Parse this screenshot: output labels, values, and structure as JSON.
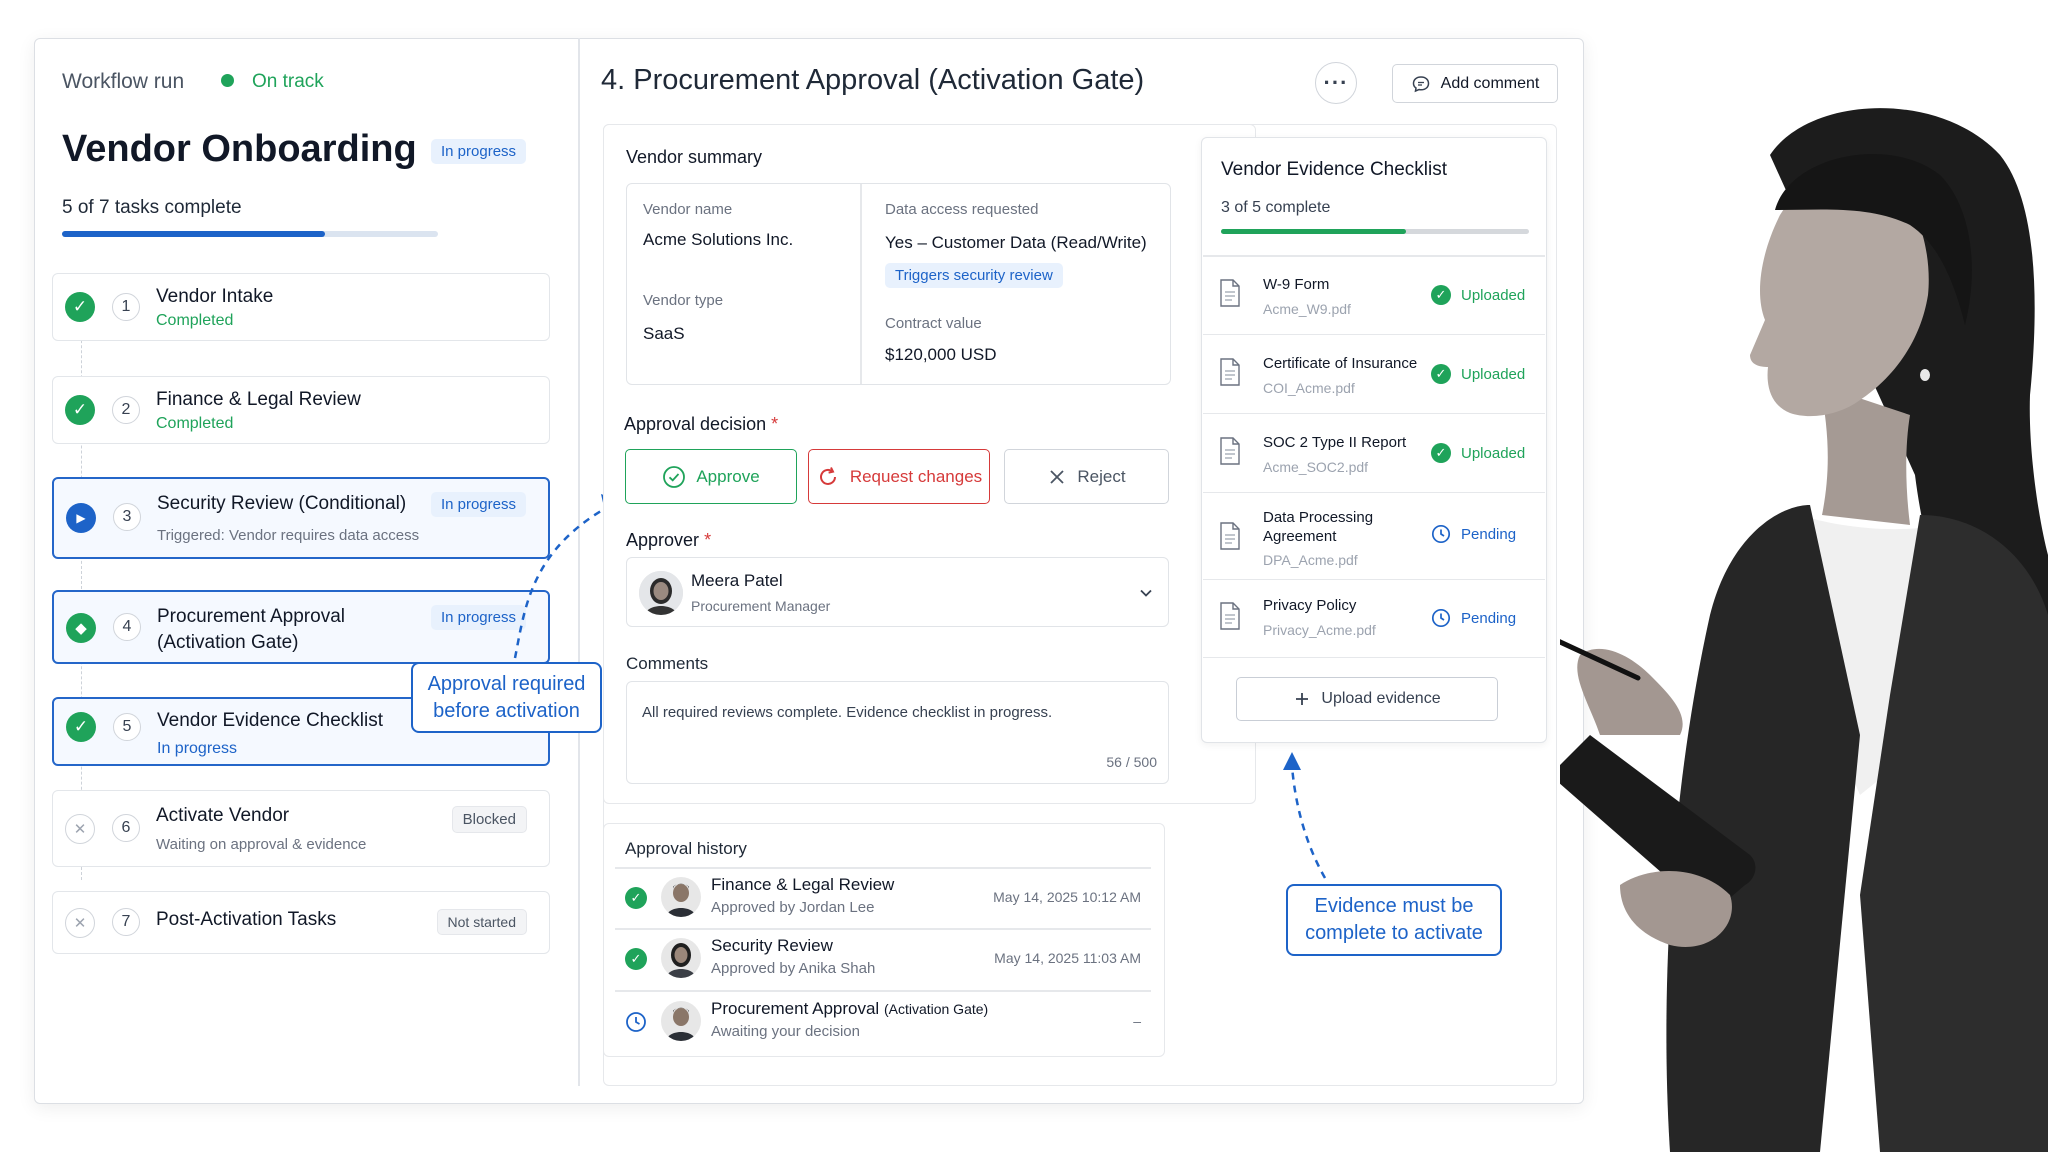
{
  "header": {
    "workflow_label": "Workflow run",
    "status_label": "On track",
    "title": "Vendor Onboarding",
    "title_badge": "In progress",
    "progress_text": "5 of 7 tasks complete",
    "progress_fraction": 0.7
  },
  "steps": [
    {
      "number": "1",
      "title": "Vendor Intake",
      "subtitle": "Completed",
      "state": "completed",
      "badge": ""
    },
    {
      "number": "2",
      "title": "Finance & Legal Review",
      "subtitle": "Completed",
      "state": "completed",
      "badge": ""
    },
    {
      "number": "3",
      "title": "Security Review (Conditional)",
      "subtitle": "Triggered: Vendor requires data access",
      "state": "in-progress",
      "badge": "In progress"
    },
    {
      "number": "4",
      "title_line1": "Procurement Approval",
      "title_line2": "(Activation Gate)",
      "state": "current",
      "badge": "In progress"
    },
    {
      "number": "5",
      "title": "Vendor Evidence Checklist",
      "subtitle": "In progress",
      "state": "completed-active",
      "badge": ""
    },
    {
      "number": "6",
      "title": "Activate Vendor",
      "subtitle": "Waiting on approval & evidence",
      "state": "blocked",
      "badge": "Blocked"
    },
    {
      "number": "7",
      "title": "Post-Activation Tasks",
      "subtitle": "",
      "state": "not-started",
      "badge": "Not started"
    }
  ],
  "callouts": {
    "approval_line1": "Approval required",
    "approval_line2": "before activation",
    "evidence_line1": "Evidence must be",
    "evidence_line2": "complete to activate"
  },
  "main": {
    "title": "4. Procurement Approval (Activation Gate)",
    "add_comment": "Add comment",
    "vendor_summary": {
      "heading": "Vendor summary",
      "vendor_name_label": "Vendor name",
      "vendor_name": "Acme Solutions Inc.",
      "vendor_type_label": "Vendor type",
      "vendor_type": "SaaS",
      "data_access_label": "Data access requested",
      "data_access": "Yes – Customer Data (Read/Write)",
      "security_tag": "Triggers security review",
      "contract_label": "Contract value",
      "contract_value": "$120,000 USD"
    },
    "approval_decision": {
      "label": "Approval decision",
      "required_mark": "*",
      "approve": "Approve",
      "request_changes": "Request changes",
      "reject": "Reject"
    },
    "approver": {
      "label": "Approver",
      "required_mark": "*",
      "name": "Meera Patel",
      "role": "Procurement Manager"
    },
    "comments": {
      "label": "Comments",
      "text": "All required reviews complete. Evidence checklist in progress.",
      "counter": "56 / 500"
    },
    "history": {
      "heading": "Approval history",
      "rows": [
        {
          "name": "Finance & Legal Review",
          "sub": "Approved by Jordan Lee",
          "time": "May 14, 2025 10:12 AM"
        },
        {
          "name": "Security Review",
          "sub": "Approved by Anika Shah",
          "time": "May 14, 2025 11:03 AM"
        },
        {
          "name": "Procurement Approval",
          "name_suffix": "(Activation Gate)",
          "sub": "Awaiting your decision",
          "time": "–"
        }
      ]
    }
  },
  "checklist": {
    "title": "Vendor Evidence Checklist",
    "progress_text": "3 of 5 complete",
    "progress_fraction": 0.6,
    "items": [
      {
        "name_line1": "W-9 Form",
        "name_line2": "",
        "file": "Acme_W9.pdf",
        "status": "Uploaded"
      },
      {
        "name_line1": "Certificate of Insurance",
        "name_line2": "",
        "file": "COI_Acme.pdf",
        "status": "Uploaded"
      },
      {
        "name_line1": "SOC 2 Type II Report",
        "name_line2": "",
        "file": "Acme_SOC2.pdf",
        "status": "Uploaded"
      },
      {
        "name_line1": "Data Processing",
        "name_line2": "Agreement",
        "file": "DPA_Acme.pdf",
        "status": "Pending"
      },
      {
        "name_line1": "Privacy Policy",
        "name_line2": "",
        "file": "Privacy_Acme.pdf",
        "status": "Pending"
      }
    ],
    "upload_button": "Upload evidence"
  },
  "colors": {
    "accent_blue": "#1d63c8",
    "success_green": "#1fa35a",
    "danger_red": "#d63a3a"
  }
}
